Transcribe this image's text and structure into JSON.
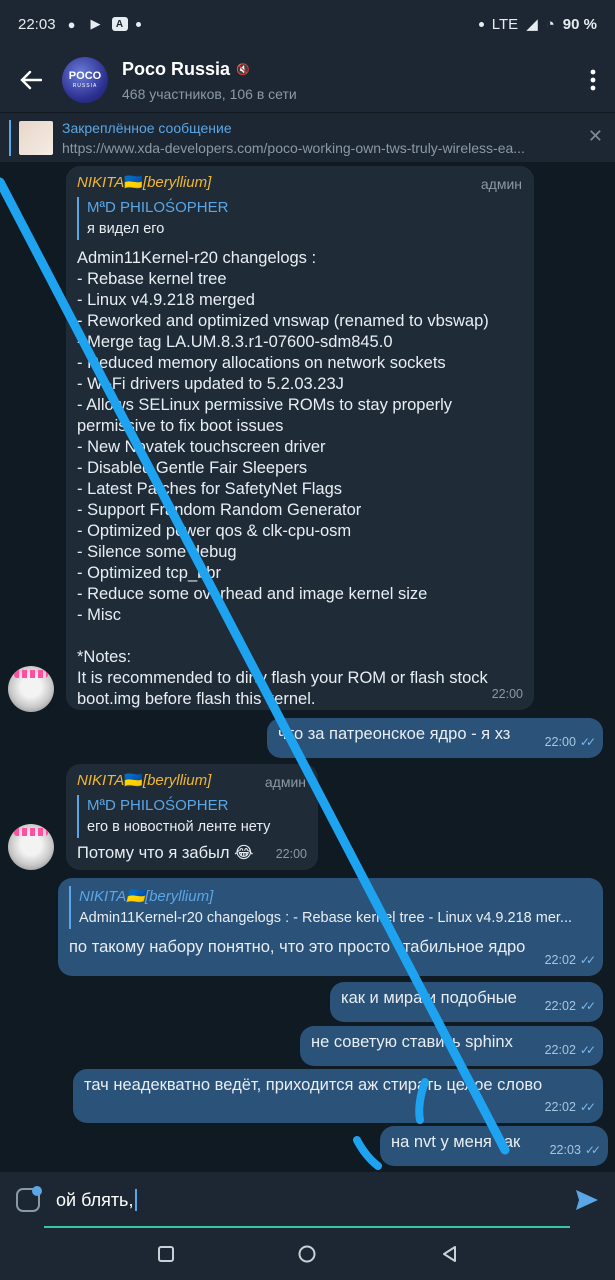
{
  "status": {
    "time": "22:03",
    "network": "LTE",
    "battery": "90 %"
  },
  "header": {
    "title": "Poco Russia",
    "avatar_top": "POCO",
    "avatar_bottom": "RUSSIA",
    "subtitle": "468 участников, 106 в сети"
  },
  "pinned": {
    "title": "Закреплённое сообщение",
    "url": "https://www.xda-developers.com/poco-working-own-tws-truly-wireless-ea..."
  },
  "messages": [
    {
      "sender": "NIKITA",
      "sender_suffix": "[beryllium]",
      "role": "админ",
      "reply_name": "MªD PHILOŚOPHER",
      "reply_text": "я видел его",
      "text": "Admin11Kernel-r20 changelogs :\n- Rebase kernel tree\n- Linux v4.9.218 merged\n- Reworked and optimized vnswap (renamed to vbswap)\n- Merge tag LA.UM.8.3.r1-07600-sdm845.0\n- Reduced memory allocations on network sockets\n- Wi-Fi drivers updated to 5.2.03.23J\n- Allows SELinux permissive ROMs to stay properly permissive to fix boot issues\n- New Novatek touchscreen driver\n- Disabled Gentle Fair Sleepers\n- Latest Patches for SafetyNet Flags\n- Support Frandom Random Generator\n- Optimized power qos & clk-cpu-osm\n- Silence some debug\n- Optimized tcp_bbr\n- Reduce some overhead and image kernel size\n- Misc\n\n*Notes:\nIt is recommended to dirty flash your ROM or flash stock boot.img before flash this kernel.",
      "time": "22:00"
    },
    {
      "text": "что за патреонское ядро - я хз",
      "time": "22:00"
    },
    {
      "sender": "NIKITA",
      "sender_suffix": "[beryllium]",
      "role": "админ",
      "reply_name": "MªD PHILOŚOPHER",
      "reply_text": "его в новостной ленте нету",
      "text": "Потому что я забыл 😂",
      "time": "22:00"
    },
    {
      "reply_name": "NIKITA🇺🇦[beryllium]",
      "reply_text": "Admin11Kernel-r20 changelogs : - Rebase kernel tree - Linux v4.9.218 mer...",
      "text": "по такому набору понятно, что это просто стабильное ядро",
      "time": "22:02"
    },
    {
      "text": "как и мира и подобные",
      "time": "22:02"
    },
    {
      "text": "не советую ставить sphinx",
      "time": "22:02"
    },
    {
      "text": "тач неадекватно ведёт, приходится аж стирать целое слово",
      "time": "22:02"
    },
    {
      "text": "на nvt у меня так",
      "time": "22:03"
    }
  ],
  "input": {
    "text": "ой блять,"
  },
  "colors": {
    "accent": "#5aa6e6",
    "outgoing": "#2b5278",
    "incoming": "#1f2c38",
    "admin_name": "#f2b632",
    "scribble": "#1ea3f0"
  }
}
